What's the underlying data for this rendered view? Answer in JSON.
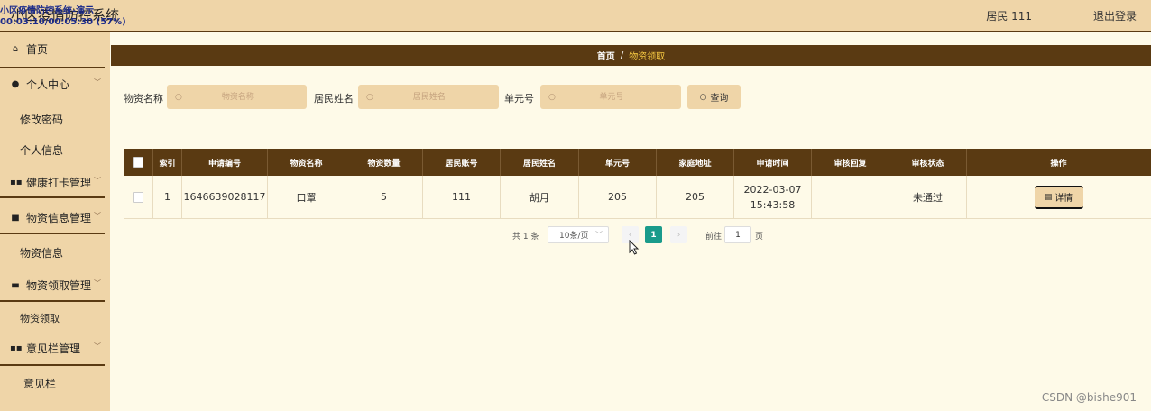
{
  "header": {
    "app_title": "小区疫情防控系统",
    "overlay_title": "小区疫情防控系统-演示",
    "overlay_time": "00:03:10/00:05:30 (57%)",
    "user_label": "居民 111",
    "logout_label": "退出登录"
  },
  "sidebar": {
    "home": "首页",
    "personal_center": "个人中心",
    "change_password": "修改密码",
    "personal_info": "个人信息",
    "health_mgmt": "健康打卡管理",
    "material_info_mgmt": "物资信息管理",
    "material_info": "物资信息",
    "material_receive_mgmt": "物资领取管理",
    "material_receive": "物资领取",
    "feedback_mgmt": "意见栏管理",
    "feedback": "意见栏"
  },
  "breadcrumb": {
    "home": "首页",
    "separator": "/",
    "current": "物资领取"
  },
  "search": {
    "material_label": "物资名称",
    "material_placeholder": "物资名称",
    "resident_label": "居民姓名",
    "resident_placeholder": "居民姓名",
    "unit_label": "单元号",
    "unit_placeholder": "单元号",
    "query_label": "查询"
  },
  "table": {
    "headers": [
      "索引",
      "申请编号",
      "物资名称",
      "物资数量",
      "居民账号",
      "居民姓名",
      "单元号",
      "家庭地址",
      "申请时间",
      "审核回复",
      "审核状态",
      "操作"
    ],
    "rows": [
      {
        "index": "1",
        "apply_no": "1646639028117",
        "material": "口罩",
        "qty": "5",
        "account": "111",
        "name": "胡月",
        "unit": "205",
        "address": "205",
        "time": "2022-03-07 15:43:58",
        "reply": "",
        "status": "未通过",
        "action": "详情"
      }
    ]
  },
  "pagination": {
    "total": "共 1 条",
    "page_size": "10条/页",
    "current_page": "1",
    "goto_label": "前往",
    "goto_value": "1",
    "page_suffix": "页"
  },
  "watermark": "CSDN @bishe901"
}
